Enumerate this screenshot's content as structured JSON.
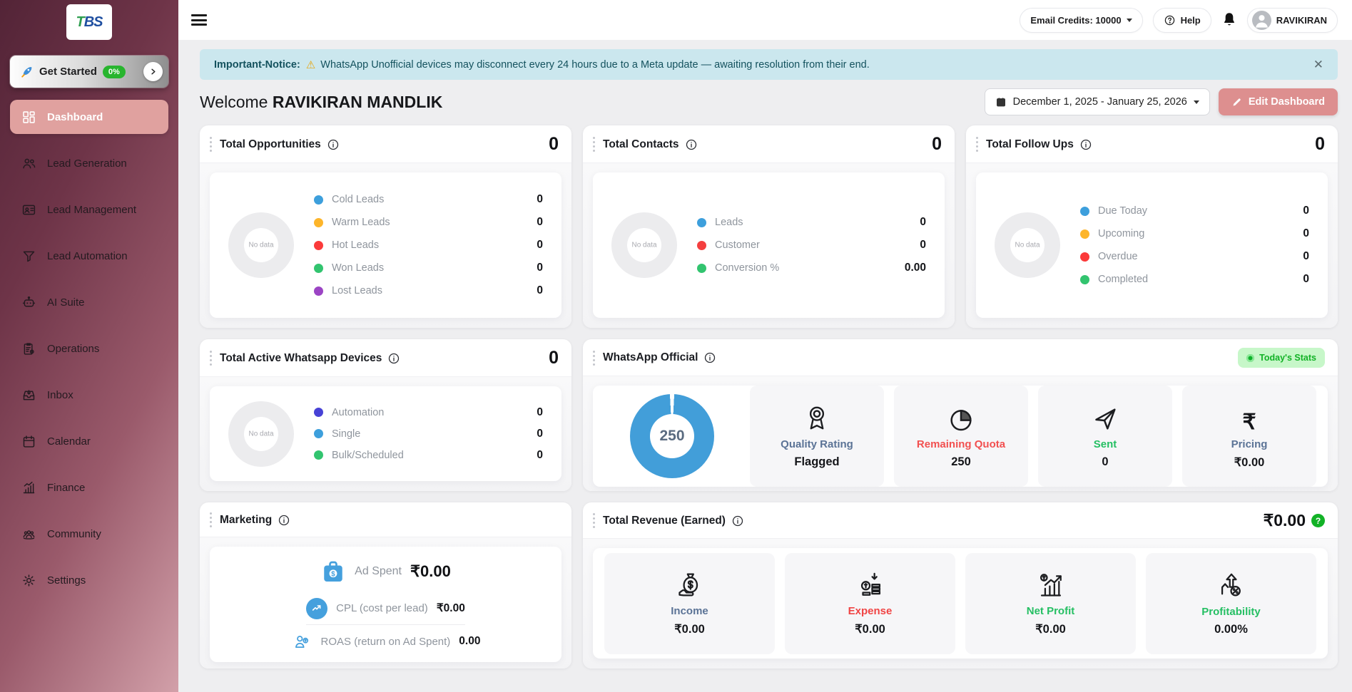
{
  "topbar": {
    "email_credits": "Email Credits: 10000",
    "help": "Help",
    "username": "RAVIKIRAN"
  },
  "sidebar": {
    "logo_green": "T",
    "logo_blue": "BS",
    "get_started": {
      "label": "Get Started",
      "badge": "0%"
    },
    "items": [
      {
        "label": "Dashboard"
      },
      {
        "label": "Lead Generation"
      },
      {
        "label": "Lead Management"
      },
      {
        "label": "Lead Automation"
      },
      {
        "label": "AI Suite"
      },
      {
        "label": "Operations"
      },
      {
        "label": "Inbox"
      },
      {
        "label": "Calendar"
      },
      {
        "label": "Finance"
      },
      {
        "label": "Community"
      },
      {
        "label": "Settings"
      }
    ]
  },
  "notice": {
    "title": "Important-Notice:",
    "message": "WhatsApp Unofficial devices may disconnect every 24 hours due to a Meta update — awaiting resolution from their end.",
    "close": "✕"
  },
  "welcome": {
    "prefix": "Welcome",
    "name": "RAVIKIRAN MANDLIK"
  },
  "controls": {
    "date_range": "December 1, 2025 - January 25, 2026",
    "edit_dashboard": "Edit Dashboard"
  },
  "ui": {
    "no_data": "No data"
  },
  "cards": {
    "opportunities": {
      "title": "Total Opportunities",
      "total": "0",
      "legend": [
        {
          "label": "Cold Leads",
          "value": "0",
          "color": "#3d9fdc"
        },
        {
          "label": "Warm Leads",
          "value": "0",
          "color": "#fdb52a"
        },
        {
          "label": "Hot Leads",
          "value": "0",
          "color": "#fb3a3a"
        },
        {
          "label": "Won Leads",
          "value": "0",
          "color": "#32c46f"
        },
        {
          "label": "Lost Leads",
          "value": "0",
          "color": "#9b44c4"
        }
      ]
    },
    "contacts": {
      "title": "Total Contacts",
      "total": "0",
      "legend": [
        {
          "label": "Leads",
          "value": "0",
          "color": "#3d9fdc"
        },
        {
          "label": "Customer",
          "value": "0",
          "color": "#f43f3f"
        },
        {
          "label": "Conversion %",
          "value": "0.00",
          "color": "#32c46f"
        }
      ]
    },
    "followups": {
      "title": "Total Follow Ups",
      "total": "0",
      "legend": [
        {
          "label": "Due Today",
          "value": "0",
          "color": "#3d9fdc"
        },
        {
          "label": "Upcoming",
          "value": "0",
          "color": "#fdb52a"
        },
        {
          "label": "Overdue",
          "value": "0",
          "color": "#fb3a3a"
        },
        {
          "label": "Completed",
          "value": "0",
          "color": "#32c46f"
        }
      ]
    },
    "devices": {
      "title": "Total Active Whatsapp Devices",
      "total": "0",
      "legend": [
        {
          "label": "Automation",
          "value": "0",
          "color": "#4742d6"
        },
        {
          "label": "Single",
          "value": "0",
          "color": "#3d9fdc"
        },
        {
          "label": "Bulk/Scheduled",
          "value": "0",
          "color": "#32c46f"
        }
      ]
    },
    "whatsapp": {
      "title": "WhatsApp Official",
      "badge": "Today's Stats",
      "donut_value": "250",
      "stats": [
        {
          "label": "Quality Rating",
          "value": "Flagged",
          "color": "#5b7396"
        },
        {
          "label": "Remaining Quota",
          "value": "250",
          "color": "#f25050"
        },
        {
          "label": "Sent",
          "value": "0",
          "color": "#25bf63"
        },
        {
          "label": "Pricing",
          "value": "₹0.00",
          "color": "#5b7396"
        }
      ]
    },
    "marketing": {
      "title": "Marketing",
      "ad_spent": {
        "label": "Ad Spent",
        "value": "₹0.00"
      },
      "rows": [
        {
          "label": "CPL (cost per lead)",
          "value": "₹0.00"
        },
        {
          "label": "ROAS (return on Ad Spent)",
          "value": "0.00"
        }
      ]
    },
    "revenue": {
      "title": "Total Revenue (Earned)",
      "total": "₹0.00",
      "stats": [
        {
          "label": "Income",
          "value": "₹0.00",
          "color": "#5b7396"
        },
        {
          "label": "Expense",
          "value": "₹0.00",
          "color": "#f04444"
        },
        {
          "label": "Net Profit",
          "value": "₹0.00",
          "color": "#25bf63"
        },
        {
          "label": "Profitability",
          "value": "0.00%",
          "color": "#25bf63"
        }
      ]
    }
  },
  "colors": {
    "accent_pink": "#dd8f8f",
    "badge_green": "#12b226",
    "donut_blue": "#429ed9"
  }
}
